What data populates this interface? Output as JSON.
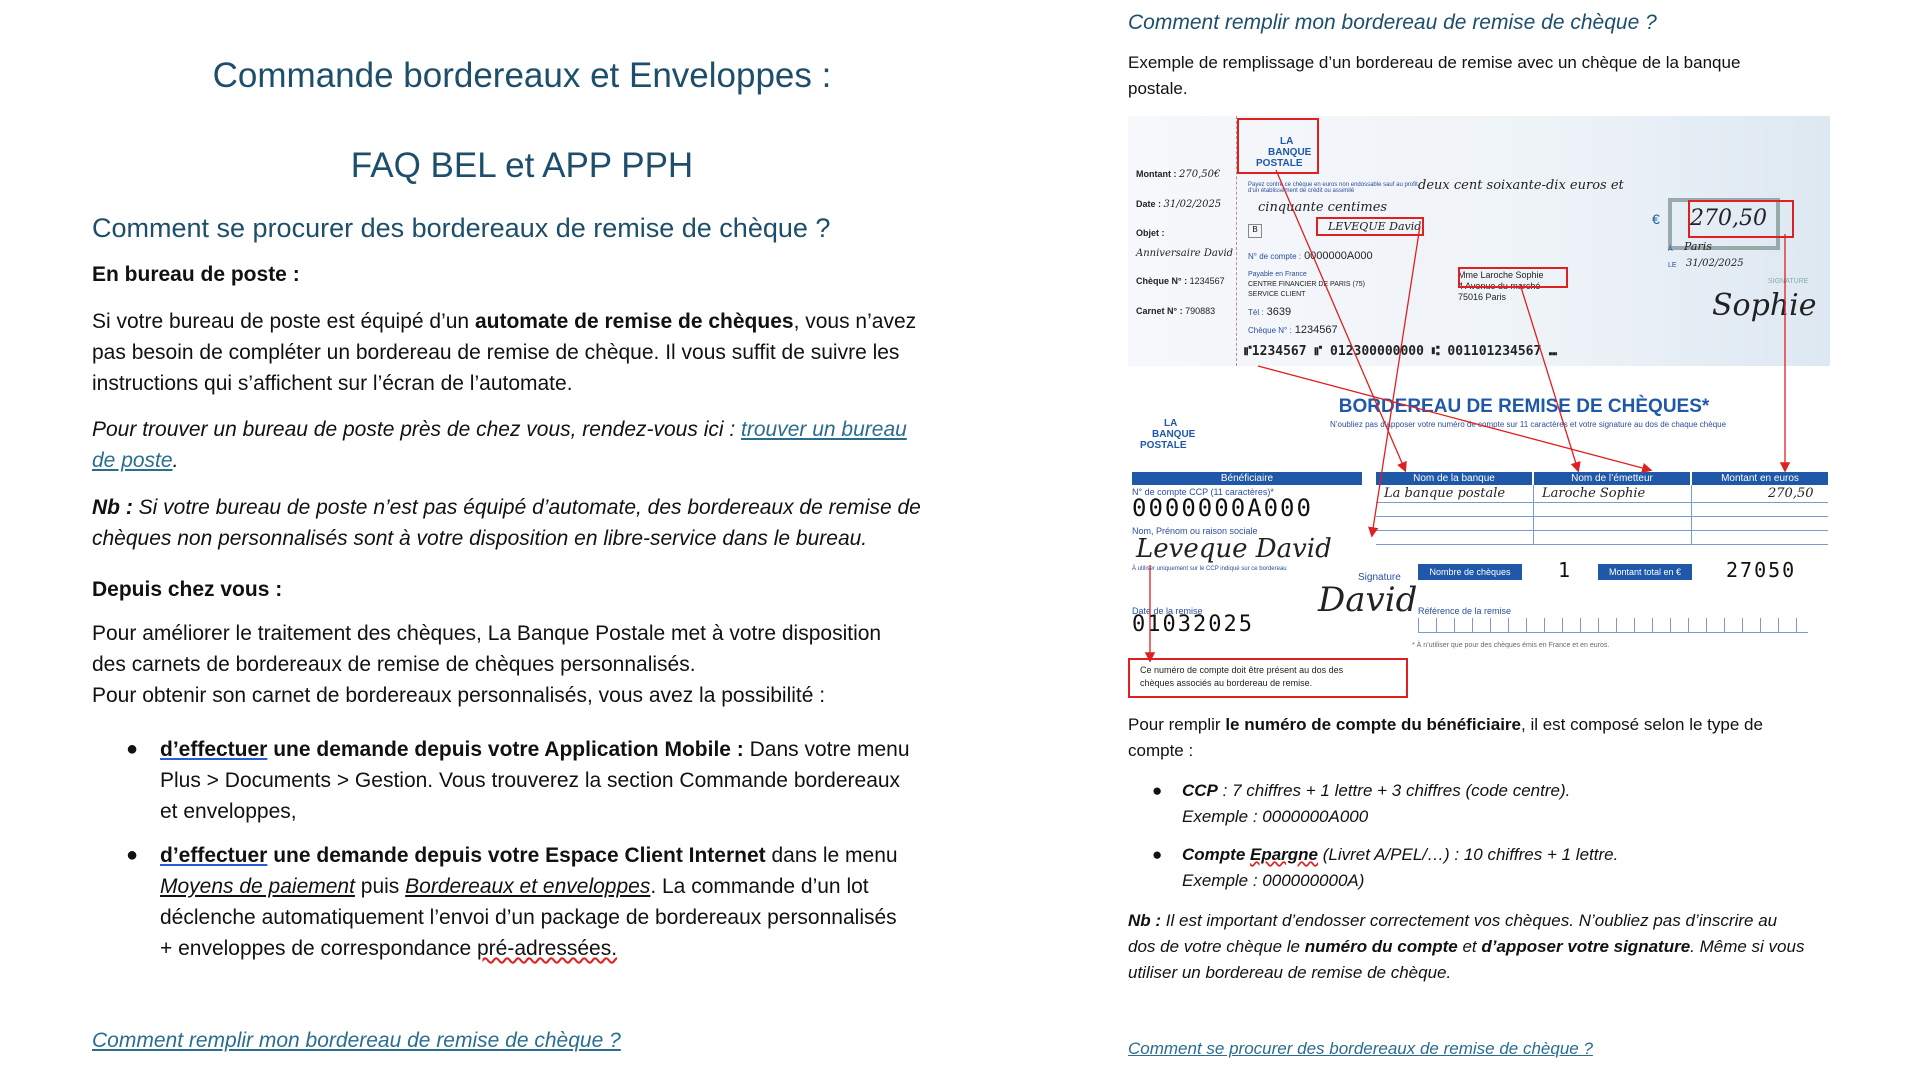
{
  "left": {
    "title1": "Commande bordereaux et Enveloppes :",
    "title2": "FAQ BEL et APP PPH",
    "section_title": "Comment se procurer des bordereaux de remise de chèque ?",
    "subhead_post": "En bureau de poste :",
    "para1_a": "Si votre bureau de poste est équipé d’un ",
    "para1_b": "automate de remise de chèques",
    "para1_c": ", vous n’avez",
    "para1_line2": "pas besoin de compléter un bordereau de remise de chèque. Il vous suffit de suivre les",
    "para1_line3": "instructions qui s’affichent sur l’écran de l’automate.",
    "para2_a": "Pour trouver un bureau de poste près de chez vous, rendez-vous ici : ",
    "para2_link1": "trouver un bureau",
    "para2_link2": "de poste",
    "para2_end": ".",
    "nb_label": "Nb :",
    "nb_line1": " Si votre bureau de poste n’est pas équipé d’automate, des bordereaux de remise de",
    "nb_line2": "chèques non personnalisés sont à votre disposition en libre-service dans le bureau.",
    "subhead_home": "Depuis chez vous :",
    "home_line1": "Pour améliorer le traitement des chèques, La Banque Postale met à votre disposition",
    "home_line2": "des carnets de bordereaux de remise de chèques personnalisés.",
    "home_line3": "Pour obtenir son carnet de bordereaux personnalisés, vous avez la possibilité :",
    "bullet1_a": "d’effectuer",
    "bullet1_b": " une demande depuis votre Application Mobile :",
    "bullet1_c": " Dans votre menu",
    "bullet1_line2": "Plus > Documents > Gestion. Vous trouverez la section Commande bordereaux",
    "bullet1_line3": "et enveloppes,",
    "bullet2_a": "d’effectuer",
    "bullet2_b": " une demande depuis votre Espace Client Internet",
    "bullet2_c": " dans le menu",
    "bullet2_l2_a": "Moyens de paiement",
    "bullet2_l2_b": " puis ",
    "bullet2_l2_c": "Bordereaux et enveloppes",
    "bullet2_l2_d": ". La commande d’un lot",
    "bullet2_line3": "déclenche automatiquement l’envoi d’un package de bordereaux personnalisés",
    "bullet2_l4_a": "+ enveloppes de correspondance ",
    "bullet2_l4_b": "pré-adressées.",
    "bottom_link": "Comment remplir mon bordereau de remise de chèque ?"
  },
  "right": {
    "title": "Comment remplir mon bordereau de remise de chèque ?",
    "intro_line1": "Exemple de remplissage d’un bordereau de remise avec un chèque de la banque",
    "intro_line2": "postale.",
    "cheque": {
      "logo_l1": "LA",
      "logo_l2": "BANQUE",
      "logo_l3": "POSTALE",
      "montant_label": "Montant :",
      "montant_val": "270,50€",
      "date_label": "Date :",
      "date_val": "31/02/2025",
      "objet_label": "Objet :",
      "objet_val": "Anniversaire David",
      "cheque_no_label": "Chèque N° :",
      "cheque_no": "1234567",
      "carnet_label": "Carnet N° :",
      "carnet_no": "790883",
      "payez_text": "Payez contre ce chèque en euros non endossable sauf au profit d'un établissement de crédit ou assimilé",
      "amount_words_1": "deux cent soixante-dix euros et",
      "amount_words_2": "cinquante centimes",
      "order_name": "LEVEQUE David",
      "compte_label": "N° de compte :",
      "compte_val": "0000000A000",
      "payable_l1": "Payable en France",
      "payable_l2": "CENTRE FINANCIER DE PARIS (75)",
      "payable_l3": "SERVICE CLIENT",
      "tel_label": "Tél :",
      "tel_val": "3639",
      "cheque_label2": "Chèque N° :",
      "cheque_no2": "1234567",
      "euro_sign": "€",
      "amount_box": "270,50",
      "a_label": "À",
      "le_label": "LE",
      "place": "Paris",
      "date2": "31/02/2025",
      "signature_label": "SIGNATURE",
      "signature": "Sophie",
      "holder_name": "Mme Laroche Sophie",
      "holder_addr1": "4 Avenue du marché",
      "holder_addr2": "75016 Paris",
      "micr": "⑈1234567 ⑈ 012300000000 ⑆ 001101234567 ⑉"
    },
    "form": {
      "title": "BORDEREAU DE REMISE DE CHÈQUES*",
      "subtitle": "N’oubliez pas d’apposer votre numéro de compte sur 11 caractères et votre signature au dos de chaque chèque",
      "beneficiaire": "Bénéficiaire",
      "ccp_label": "N° de compte CCP (11 caractères)*",
      "ccp_digits": "0000000A000",
      "name_label": "Nom, Prénom ou raison sociale",
      "name_val": "Leveque David",
      "name_note": "À utiliser uniquement sur le CCP indiqué sur ce bordereau",
      "signature_label": "Signature",
      "signature_val": "David",
      "date_label": "Date de la remise",
      "date_digits": "01032025",
      "col_bank": "Nom de la banque",
      "col_emitter": "Nom de l’émetteur",
      "col_amount": "Montant en euros",
      "row_bank": "La banque postale",
      "row_emitter": "Laroche Sophie",
      "row_amount": "270,50",
      "nb_cheques_label": "Nombre de chèques",
      "nb_cheques": "1",
      "total_label": "Montant total en €",
      "total": "27050",
      "ref_label": "Référence de la remise",
      "footnote": "* À n’utiliser que pour des chèques émis en France et en euros.",
      "callout_l1": "Ce numéro de compte doit être présent au dos des",
      "callout_l2": "chèques associés au bordereau de remise."
    },
    "fill_a": "Pour remplir ",
    "fill_b": "le numéro de compte du bénéficiaire",
    "fill_c": ", il est composé selon le type de",
    "fill_line2": "compte :",
    "ccp_title": "CCP",
    "ccp_desc": " : 7 chiffres + 1 lettre + 3 chiffres (code centre).",
    "ccp_example": "Exemple : 0000000A000",
    "ep_title_a": "Compte ",
    "ep_title_b": "Epargne",
    "ep_desc": " (Livret A/PEL/…) : 10 chiffres + 1 lettre.",
    "ep_example": "Exemple : 000000000A)",
    "nb_label": "Nb :",
    "nb_line1": " Il est important d’endosser correctement vos chèques. N’oubliez pas d’inscrire au",
    "nb_l2_a": "dos de votre chèque le ",
    "nb_l2_b": "numéro du compte",
    "nb_l2_c": " et ",
    "nb_l2_d": "d’apposer votre signature",
    "nb_l2_e": ". Même si vous",
    "nb_line3": "utiliser un bordereau de remise de chèque.",
    "bottom_link": "Comment se procurer des bordereaux de remise de chèque ?"
  },
  "colors": {
    "heading": "#1d4e6b",
    "link": "#2a6d8f",
    "brand_blue": "#1f58a8",
    "annotation_red": "#e02020"
  }
}
